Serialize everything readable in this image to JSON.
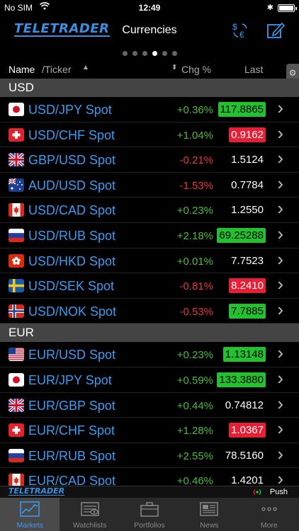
{
  "status": {
    "carrier": "No SIM",
    "time": "12:49"
  },
  "nav": {
    "logo": "TELETRADER",
    "title": "Currencies"
  },
  "pager": {
    "count": 6,
    "active": 3
  },
  "columns": {
    "name": "Name",
    "ticker": "/Ticker",
    "chg": "Chg %",
    "last": "Last"
  },
  "sections": [
    {
      "title": "USD",
      "rows": [
        {
          "flag": "jp",
          "name": "USD/JPY Spot",
          "chg": "+0.36%",
          "dir": "pos",
          "last": "117.8865",
          "highlight": "up"
        },
        {
          "flag": "ch",
          "name": "USD/CHF Spot",
          "chg": "+1.04%",
          "dir": "pos",
          "last": "0.9162",
          "highlight": "down"
        },
        {
          "flag": "gb",
          "name": "GBP/USD Spot",
          "chg": "-0.21%",
          "dir": "neg",
          "last": "1.5124",
          "highlight": ""
        },
        {
          "flag": "au",
          "name": "AUD/USD Spot",
          "chg": "-1.53%",
          "dir": "neg",
          "last": "0.7784",
          "highlight": ""
        },
        {
          "flag": "ca",
          "name": "USD/CAD Spot",
          "chg": "+0.23%",
          "dir": "pos",
          "last": "1.2550",
          "highlight": ""
        },
        {
          "flag": "ru",
          "name": "USD/RUB Spot",
          "chg": "+2.18%",
          "dir": "pos",
          "last": "69.25288",
          "highlight": "up"
        },
        {
          "flag": "hk",
          "name": "USD/HKD Spot",
          "chg": "+0.01%",
          "dir": "pos",
          "last": "7.7523",
          "highlight": ""
        },
        {
          "flag": "se",
          "name": "USD/SEK Spot",
          "chg": "-0.81%",
          "dir": "neg",
          "last": "8.2410",
          "highlight": "down"
        },
        {
          "flag": "no",
          "name": "USD/NOK Spot",
          "chg": "-0.53%",
          "dir": "neg",
          "last": "7.7885",
          "highlight": "up"
        }
      ]
    },
    {
      "title": "EUR",
      "rows": [
        {
          "flag": "us",
          "name": "EUR/USD Spot",
          "chg": "+0.23%",
          "dir": "pos",
          "last": "1.13148",
          "highlight": "up"
        },
        {
          "flag": "jp",
          "name": "EUR/JPY Spot",
          "chg": "+0.59%",
          "dir": "pos",
          "last": "133.3880",
          "highlight": "up"
        },
        {
          "flag": "gb",
          "name": "EUR/GBP Spot",
          "chg": "+0.44%",
          "dir": "pos",
          "last": "0.74812",
          "highlight": ""
        },
        {
          "flag": "ch",
          "name": "EUR/CHF Spot",
          "chg": "+1.28%",
          "dir": "pos",
          "last": "1.0367",
          "highlight": "down"
        },
        {
          "flag": "ru",
          "name": "EUR/RUB Spot",
          "chg": "+2.55%",
          "dir": "pos",
          "last": "78.5160",
          "highlight": ""
        },
        {
          "flag": "ca",
          "name": "EUR/CAD Spot",
          "chg": "+0.46%",
          "dir": "pos",
          "last": "1.4201",
          "highlight": ""
        }
      ]
    }
  ],
  "pushbar": {
    "logo": "TELETRADER",
    "push": "Push"
  },
  "tabs": [
    {
      "label": "Markets",
      "icon": "chart-icon",
      "active": true
    },
    {
      "label": "Watchlists",
      "icon": "eye-list-icon",
      "active": false
    },
    {
      "label": "Portfolios",
      "icon": "briefcase-icon",
      "active": false
    },
    {
      "label": "News",
      "icon": "newspaper-icon",
      "active": false
    },
    {
      "label": "More",
      "icon": "more-icon",
      "active": false
    }
  ],
  "colors": {
    "accent": "#3a9cf0",
    "positive": "#4cbb3c",
    "negative": "#e8363b",
    "up_bg": "#22c22e",
    "down_bg": "#e81f34"
  }
}
